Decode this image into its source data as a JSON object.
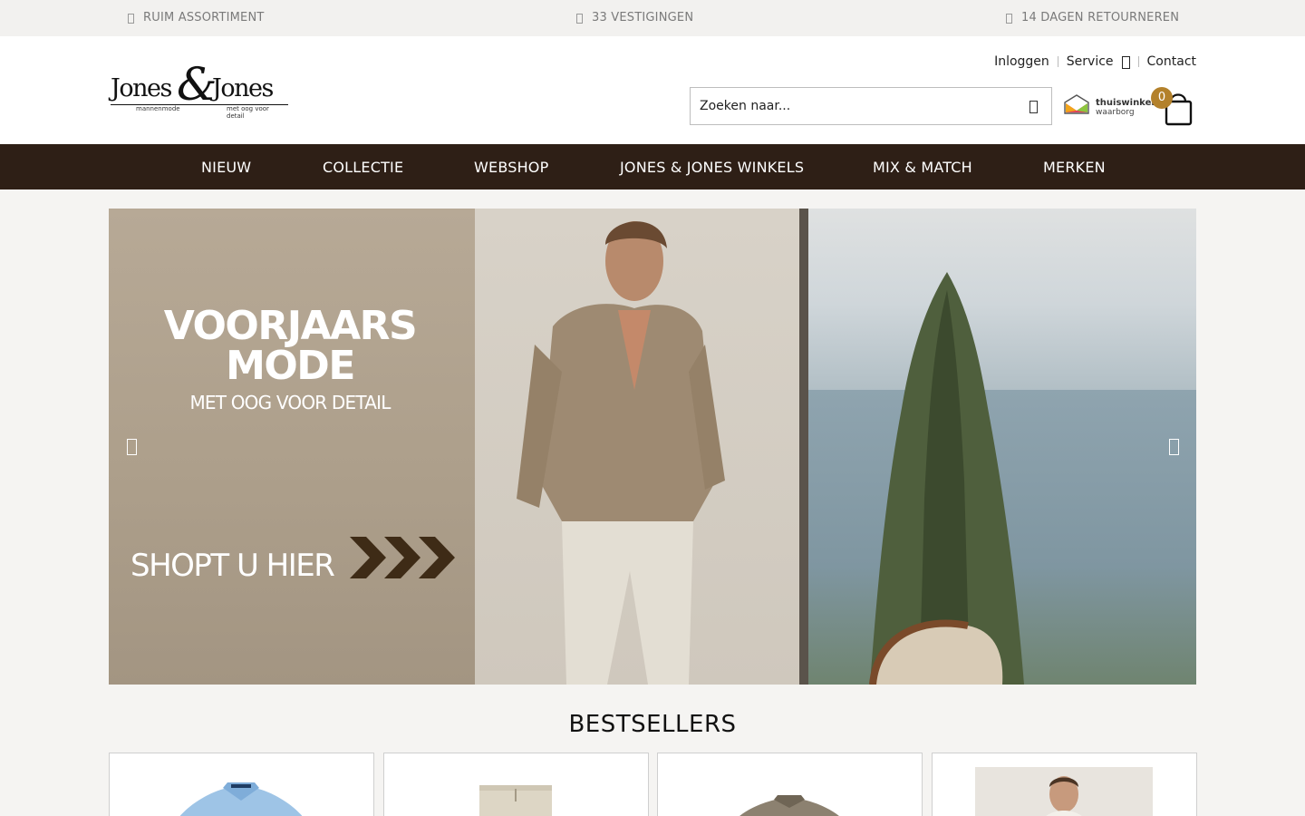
{
  "usp": [
    {
      "label": "RUIM ASSORTIMENT",
      "icon": "check-icon"
    },
    {
      "label": "33 VESTIGINGEN",
      "icon": "store-icon"
    },
    {
      "label": "14 DAGEN RETOURNEREN",
      "icon": "return-icon"
    }
  ],
  "brand": {
    "word_left": "Jones",
    "ampersand": "&",
    "word_right": "Jones",
    "tagline_left": "mannenmode",
    "tagline_right": "met oog voor detail"
  },
  "toplinks": {
    "login": "Inloggen",
    "service": "Service",
    "contact": "Contact"
  },
  "search": {
    "placeholder": "Zoeken naar...",
    "icon": "search-icon"
  },
  "waarborg": {
    "line1": "thuiswinkel",
    "line2": "waarborg"
  },
  "cart": {
    "count": "0",
    "icon": "shopping-bag-icon",
    "badge_color": "#b3812b"
  },
  "nav": {
    "items": [
      "NIEUW",
      "COLLECTIE",
      "WEBSHOP",
      "JONES & JONES WINKELS",
      "MIX & MATCH",
      "MERKEN"
    ]
  },
  "hero": {
    "title_line1": "VOORJAARS",
    "title_line2": "MODE",
    "subtitle": "MET OOG VOOR DETAIL",
    "cta": "SHOPT U HIER",
    "prev_icon": "chevron-left-icon",
    "next_icon": "chevron-right-icon"
  },
  "bestsellers": {
    "title": "BESTSELLERS"
  },
  "colors": {
    "nav_bg": "#2e1f16",
    "accent": "#b3812b",
    "page_bg": "#f5f4f2"
  }
}
